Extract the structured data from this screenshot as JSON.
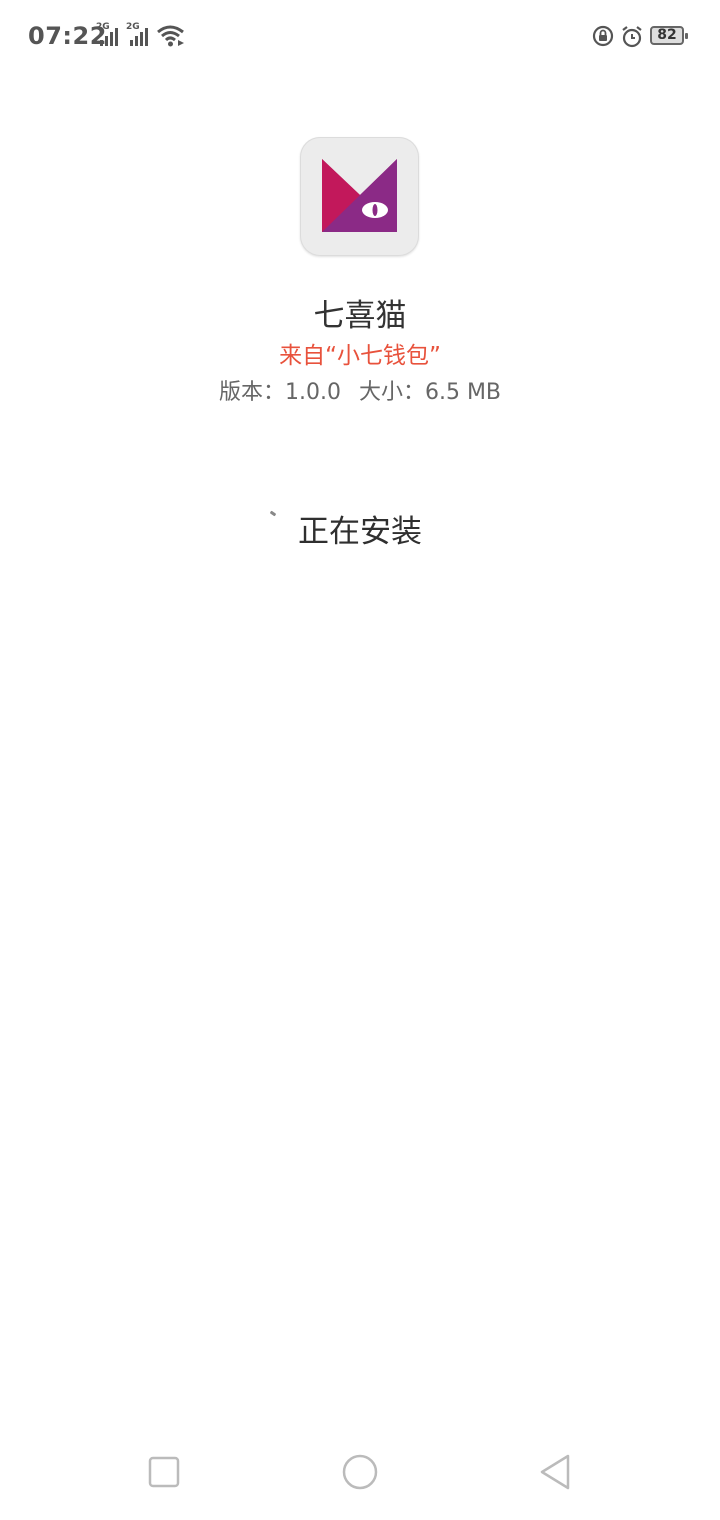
{
  "status_bar": {
    "time": "07:22",
    "sim1_network": "2G",
    "sim2_network": "2G",
    "battery_level": "82",
    "icons": [
      "signal-icon",
      "signal-icon",
      "wifi-icon",
      "rotation-lock-icon",
      "alarm-icon",
      "battery-icon"
    ]
  },
  "app": {
    "name": "七喜猫",
    "source": "来自“小七钱包”",
    "version_label": "版本：",
    "version": "1.0.0",
    "size_label": "大小：",
    "size": "6.5 MB",
    "icon": "app-logo-icon",
    "colors": {
      "logo_primary": "#c2185b",
      "logo_secondary": "#7b1fa2"
    }
  },
  "install": {
    "status": "正在安装"
  },
  "nav_bar": {
    "icons": [
      "recent-apps-icon",
      "home-icon",
      "back-icon"
    ]
  }
}
